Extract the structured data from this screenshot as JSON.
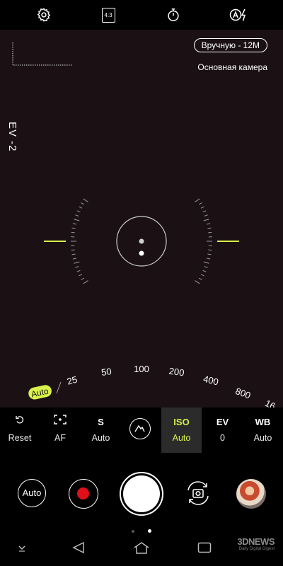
{
  "topbar": {
    "icons": [
      "gear-icon",
      "aspect-ratio-icon",
      "timer-icon",
      "auto-flash-icon"
    ],
    "aspect_label": "4:3"
  },
  "viewfinder": {
    "mode_pill": "Вручную - 12M",
    "camera_label": "Основная камера",
    "ev_label": "EV -2"
  },
  "iso_dial": {
    "selected": "Auto",
    "values": [
      "25",
      "50",
      "100",
      "200",
      "400",
      "800",
      "16"
    ]
  },
  "settings": [
    {
      "title": "Reset",
      "value": "",
      "icon": "reset-icon"
    },
    {
      "title": "AF",
      "value": "",
      "icon": "af-focus-icon"
    },
    {
      "title": "S",
      "value": "Auto"
    },
    {
      "title": "",
      "value": "",
      "icon": "mountain-scene-icon"
    },
    {
      "title": "ISO",
      "value": "Auto",
      "active": true
    },
    {
      "title": "EV",
      "value": "0"
    },
    {
      "title": "WB",
      "value": "Auto"
    }
  ],
  "controls": {
    "auto_label": "Auto",
    "icons": [
      "record-button",
      "shutter-button",
      "switch-camera-icon",
      "gallery-thumbnail"
    ],
    "page_indicator": {
      "count": 2,
      "active": 2
    }
  },
  "navbar": {
    "icons": [
      "keyboard-hide-icon",
      "back-icon",
      "home-icon",
      "recents-icon"
    ]
  },
  "watermark": {
    "brand": "3DNEWS",
    "tagline": "Daily Digital Digest"
  },
  "colors": {
    "accent": "#d9f24a",
    "viewfinder_bg": "#1b1115",
    "record_red": "#e0101a"
  }
}
